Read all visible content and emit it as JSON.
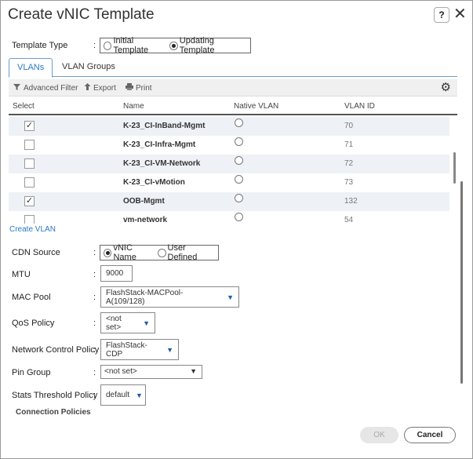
{
  "dialog": {
    "title": "Create vNIC Template",
    "help_label": "?",
    "close_label": "✕"
  },
  "template_type": {
    "label": "Template Type",
    "colon": ":",
    "options": [
      "Initial Template",
      "Updating Template"
    ],
    "selected": "Updating Template"
  },
  "tabs": [
    "VLANs",
    "VLAN Groups"
  ],
  "active_tab": "VLANs",
  "toolbar": {
    "advanced_filter": "Advanced Filter",
    "export": "Export",
    "print": "Print",
    "settings_icon": "gear-icon"
  },
  "table": {
    "columns": [
      "Select",
      "Name",
      "Native VLAN",
      "VLAN ID"
    ],
    "rows": [
      {
        "selected": true,
        "name": "K-23_CI-InBand-Mgmt",
        "vlan_id": "70"
      },
      {
        "selected": false,
        "name": "K-23_CI-Infra-Mgmt",
        "vlan_id": "71"
      },
      {
        "selected": false,
        "name": "K-23_CI-VM-Network",
        "vlan_id": "72"
      },
      {
        "selected": false,
        "name": "K-23_CI-vMotion",
        "vlan_id": "73"
      },
      {
        "selected": true,
        "name": "OOB-Mgmt",
        "vlan_id": "132"
      },
      {
        "selected": false,
        "name": "vm-network",
        "vlan_id": "54"
      }
    ],
    "check_mark": "✓"
  },
  "create_vlan": "Create VLAN",
  "cdn_source": {
    "label": "CDN Source",
    "colon": ":",
    "options": [
      "vNIC Name",
      "User Defined"
    ],
    "selected": "vNIC Name"
  },
  "mtu": {
    "label": "MTU",
    "colon": ":",
    "value": "9000"
  },
  "mac_pool": {
    "label": "MAC Pool",
    "colon": ":",
    "value": "FlashStack-MACPool-A(109/128)"
  },
  "qos_policy": {
    "label": "QoS Policy",
    "colon": ":",
    "value": "<not set>"
  },
  "network_control_policy": {
    "label": "Network Control Policy",
    "colon": ":",
    "value": "FlashStack-CDP"
  },
  "pin_group": {
    "label": "Pin Group",
    "colon": ":",
    "value": "<not set>"
  },
  "stats_threshold_policy": {
    "label": "Stats Threshold Policy",
    "colon": ":",
    "value": "default"
  },
  "connection_policies": "Connection Policies",
  "buttons": {
    "ok": "OK",
    "cancel": "Cancel"
  },
  "colors": {
    "accent": "#2a77c5",
    "row_alt": "#eef1f6"
  }
}
